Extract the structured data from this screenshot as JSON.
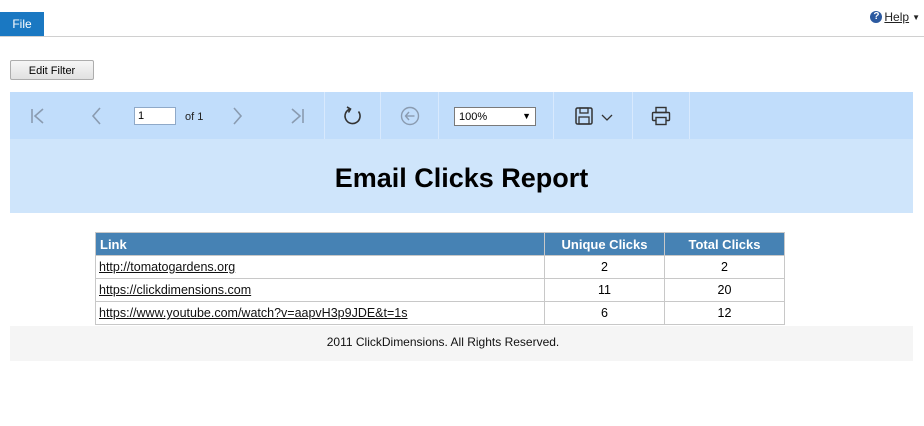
{
  "menu": {
    "file_label": "File"
  },
  "help": {
    "label": "Help",
    "icon": "help-circle-icon"
  },
  "filter": {
    "edit_label": "Edit Filter"
  },
  "toolbar": {
    "page_value": "1",
    "of_label": "of 1",
    "zoom_value": "100%",
    "icons": [
      "first-page-icon",
      "previous-page-icon",
      "next-page-icon",
      "last-page-icon",
      "refresh-icon",
      "back-icon",
      "save-icon",
      "print-icon"
    ],
    "background": "#c1ddfb"
  },
  "report": {
    "title": "Email Clicks Report",
    "columns": [
      "Link",
      "Unique Clicks",
      "Total Clicks"
    ],
    "rows": [
      {
        "link": "http://tomatogardens.org",
        "unique": "2",
        "total": "2"
      },
      {
        "link": "https://clickdimensions.com",
        "unique": "11",
        "total": "20"
      },
      {
        "link": "https://www.youtube.com/watch?v=aapvH3p9JDE&t=1s",
        "unique": "6",
        "total": "12"
      }
    ],
    "header_color": "#4682b4",
    "footer": "2011 ClickDimensions. All Rights Reserved."
  }
}
